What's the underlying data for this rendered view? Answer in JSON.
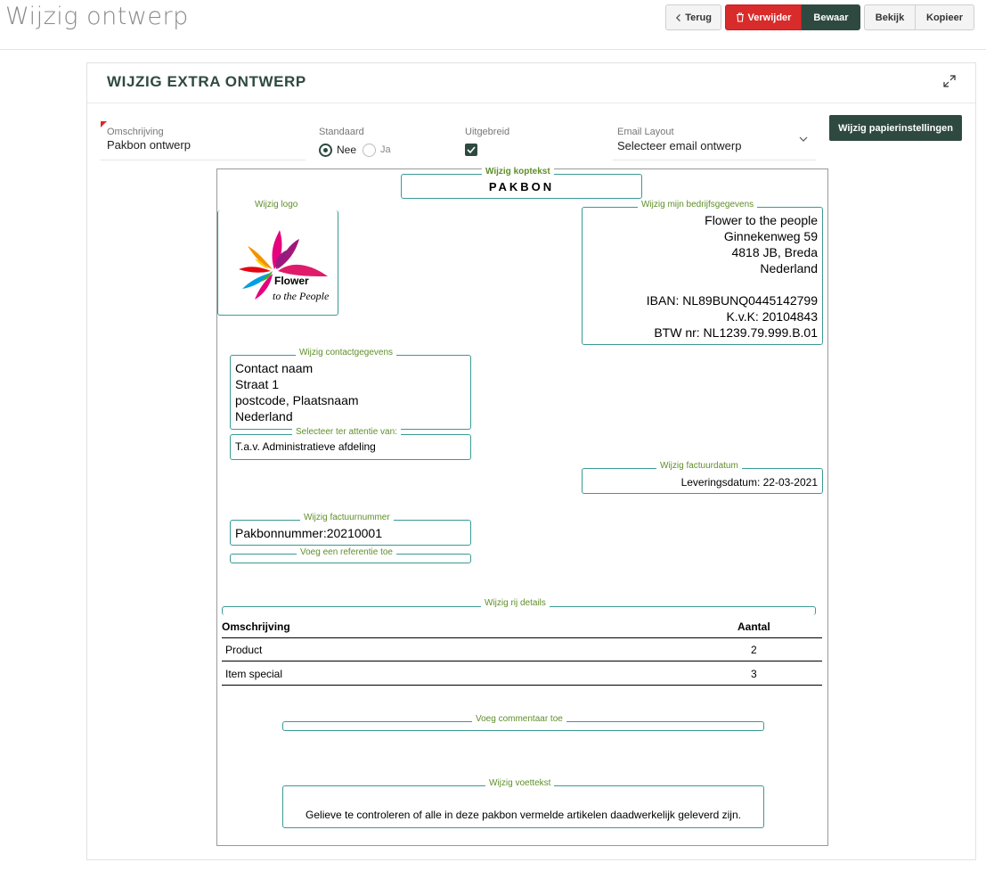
{
  "header": {
    "title": "Wijzig ontwerp",
    "buttons": {
      "back": "Terug",
      "delete": "Verwijder",
      "save": "Bewaar",
      "view": "Bekijk",
      "copy": "Kopieer"
    }
  },
  "panel": {
    "title": "WIJZIG EXTRA ONTWERP",
    "fields": {
      "description_label": "Omschrijving",
      "description_value": "Pakbon ontwerp",
      "standard_label": "Standaard",
      "standard_options": [
        "Nee",
        "Ja"
      ],
      "standard_selected": "Nee",
      "extended_label": "Uitgebreid",
      "extended_checked": true,
      "email_layout_label": "Email Layout",
      "email_layout_value": "Selecteer email ontwerp"
    },
    "paper_button": "Wijzig papierinstellingen"
  },
  "document": {
    "header_label": "Wijzig koptekst",
    "header_text": "PAKBON",
    "logo_label": "Wijzig logo",
    "logo_text_main": "Flower",
    "logo_text_sub": "to the People",
    "company_label": "Wijzig mijn bedrijfsgegevens",
    "company_lines": [
      "Flower to the people",
      "Ginnekenweg 59",
      "4818 JB, Breda",
      "Nederland",
      "",
      "IBAN: NL89BUNQ0445142799",
      "K.v.K: 20104843",
      "BTW nr: NL1239.79.999.B.01"
    ],
    "contact_label": "Wijzig contactgegevens",
    "contact_lines": [
      "Contact naam",
      "Straat 1",
      "postcode, Plaatsnaam",
      "Nederland"
    ],
    "attention_label": "Selecteer ter attentie van:",
    "attention_value": "T.a.v. Administratieve afdeling",
    "date_label": "Wijzig factuurdatum",
    "date_value": "Leveringsdatum: 22-03-2021",
    "number_label": "Wijzig factuurnummer",
    "number_value": "Pakbonnummer:20210001",
    "reference_label": "Voeg een referentie toe",
    "rows_label": "Wijzig rij details",
    "table": {
      "columns": [
        "Omschrijving",
        "Aantal"
      ],
      "rows": [
        {
          "description": "Product",
          "qty": "2"
        },
        {
          "description": "Item special",
          "qty": "3"
        }
      ]
    },
    "comment_label": "Voeg commentaar toe",
    "footer_label": "Wijzig voettekst",
    "footer_text": "Gelieve te controleren of alle in deze pakbon vermelde artikelen daadwerkelijk geleverd zijn."
  },
  "colors": {
    "brand": "#2e4a40",
    "danger": "#d82b2b",
    "outline": "#3a9a95",
    "label_green": "#5f8f2a"
  }
}
